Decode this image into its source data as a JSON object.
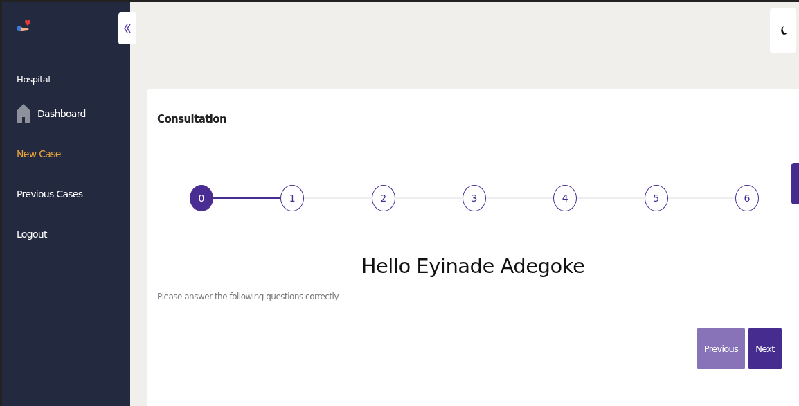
{
  "sidebar": {
    "section": "Hospital",
    "items": [
      {
        "label": "Dashboard",
        "kind": "iconed",
        "selected": false
      },
      {
        "label": "New Case",
        "kind": "plain",
        "selected": true
      },
      {
        "label": "Previous Cases",
        "kind": "plain",
        "selected": false
      },
      {
        "label": "Logout",
        "kind": "plain",
        "selected": false
      }
    ]
  },
  "card": {
    "title": "Consultation",
    "steps": [
      {
        "label": "0",
        "selected": true
      },
      {
        "label": "1",
        "selected": false
      },
      {
        "label": "2",
        "selected": false
      },
      {
        "label": "3",
        "selected": false
      },
      {
        "label": "4",
        "selected": false
      },
      {
        "label": "5",
        "selected": false
      },
      {
        "label": "6",
        "selected": false
      }
    ],
    "greeting": "Hello Eyinade Adegoke",
    "instruction": "Please answer the following questions correctly",
    "buttons": [
      {
        "label": "Previous",
        "kind": "secondary"
      },
      {
        "label": "Next",
        "kind": "primary"
      }
    ]
  }
}
